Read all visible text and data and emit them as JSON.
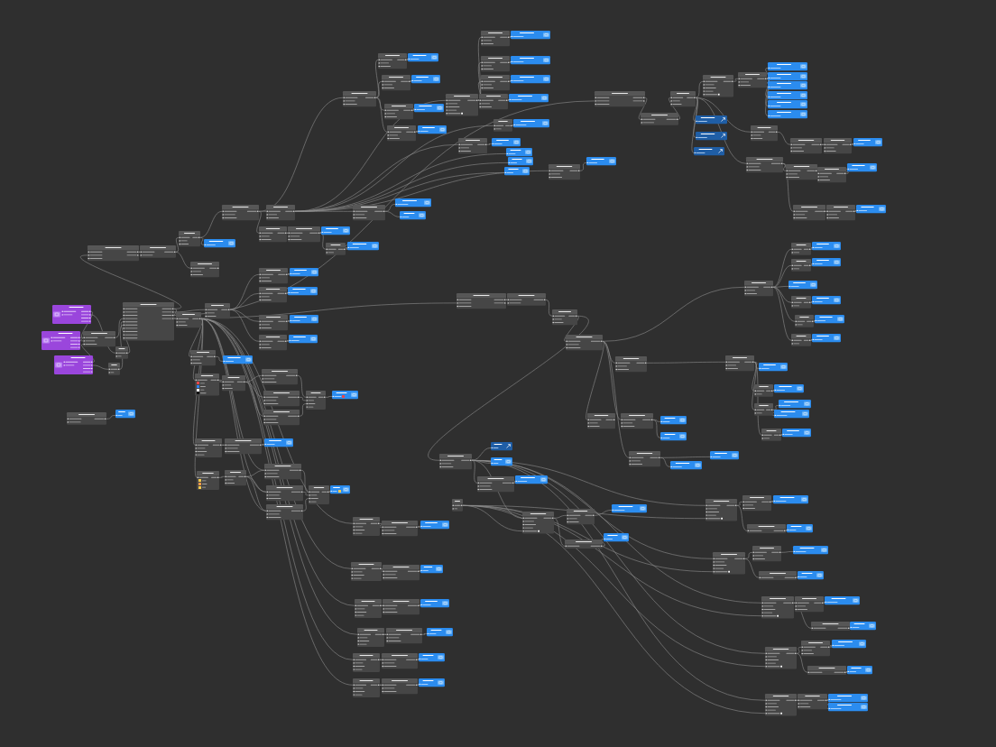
{
  "canvas": {
    "nodes": [
      {
        "kind": "patch",
        "rows": [
          {
            "kind": "pair"
          },
          {
            "kind": "input"
          },
          {
            "kind": "input"
          }
        ]
      },
      {
        "kind": "layer"
      },
      {
        "kind": "patch",
        "rows": [
          {
            "kind": "pair"
          },
          {
            "kind": "input"
          },
          {
            "kind": "input"
          }
        ]
      },
      {
        "kind": "layer"
      },
      {
        "kind": "patch",
        "rows": [
          {
            "kind": "pair"
          },
          {
            "kind": "input"
          },
          {
            "kind": "input"
          }
        ]
      },
      {
        "kind": "layer"
      },
      {
        "kind": "patch",
        "rows": [
          {
            "kind": "pair"
          },
          {
            "kind": "input"
          },
          {
            "kind": "input"
          }
        ]
      },
      {
        "kind": "layer"
      },
      {
        "kind": "patch",
        "rows": [
          {
            "kind": "pair"
          },
          {
            "kind": "input"
          },
          {
            "kind": "input"
          }
        ]
      },
      {
        "kind": "layer"
      },
      {
        "kind": "patch",
        "rows": [
          {
            "kind": "pair"
          },
          {
            "kind": "input"
          },
          {
            "kind": "input"
          }
        ]
      },
      {
        "kind": "patch",
        "rows": [
          {
            "kind": "pair"
          },
          {
            "kind": "input"
          },
          {
            "kind": "input"
          },
          {
            "kind": "input"
          },
          {
            "kind": "toggle"
          }
        ]
      },
      {
        "kind": "patch",
        "rows": [
          {
            "kind": "pair"
          },
          {
            "kind": "input"
          },
          {
            "kind": "input"
          }
        ]
      },
      {
        "kind": "layer"
      },
      {
        "kind": "patch",
        "rows": [
          {
            "kind": "pair"
          },
          {
            "kind": "input"
          },
          {
            "kind": "input"
          }
        ]
      },
      {
        "kind": "layer"
      },
      {
        "kind": "patch",
        "rows": [
          {
            "kind": "pair"
          },
          {
            "kind": "input"
          }
        ]
      },
      {
        "kind": "layer"
      },
      {
        "kind": "patch",
        "rows": [
          {
            "kind": "pair"
          },
          {
            "kind": "input"
          },
          {
            "kind": "input"
          }
        ]
      },
      {
        "kind": "layer"
      },
      {
        "kind": "patch",
        "rows": [
          {
            "kind": "pair"
          },
          {
            "kind": "input"
          },
          {
            "kind": "input"
          }
        ]
      },
      {
        "kind": "layer"
      },
      {
        "kind": "layer"
      },
      {
        "kind": "layer"
      },
      {
        "kind": "layer"
      },
      {
        "kind": "patch",
        "rows": [
          {
            "kind": "pair"
          },
          {
            "kind": "input"
          },
          {
            "kind": "input"
          }
        ]
      },
      {
        "kind": "layer"
      },
      {
        "kind": "patch",
        "rows": [
          {
            "kind": "pair"
          },
          {
            "kind": "pair"
          },
          {
            "kind": "input"
          }
        ]
      },
      {
        "kind": "patch",
        "rows": [
          {
            "kind": "pair"
          },
          {
            "kind": "input"
          }
        ]
      },
      {
        "kind": "patch",
        "rows": [
          {
            "kind": "pair"
          },
          {
            "kind": "input"
          },
          {
            "kind": "input"
          }
        ]
      },
      {
        "kind": "patch",
        "rows": [
          {
            "kind": "pair"
          },
          {
            "kind": "input"
          },
          {
            "kind": "input"
          },
          {
            "kind": "input"
          },
          {
            "kind": "toggle"
          }
        ]
      },
      {
        "kind": "patch",
        "rows": [
          {
            "kind": "pair"
          },
          {
            "kind": "input"
          },
          {
            "kind": "input"
          }
        ]
      },
      {
        "kind": "layer"
      },
      {
        "kind": "layer"
      },
      {
        "kind": "layer"
      },
      {
        "kind": "layer"
      },
      {
        "kind": "layer"
      },
      {
        "kind": "layer"
      },
      {
        "kind": "group"
      },
      {
        "kind": "group"
      },
      {
        "kind": "group"
      },
      {
        "kind": "patch",
        "rows": [
          {
            "kind": "pair"
          },
          {
            "kind": "input"
          },
          {
            "kind": "input"
          }
        ]
      },
      {
        "kind": "patch",
        "rows": [
          {
            "kind": "pair"
          },
          {
            "kind": "input"
          },
          {
            "kind": "input"
          }
        ]
      },
      {
        "kind": "patch",
        "rows": [
          {
            "kind": "pair"
          },
          {
            "kind": "input"
          },
          {
            "kind": "input"
          }
        ]
      },
      {
        "kind": "layer"
      },
      {
        "kind": "patch",
        "rows": [
          {
            "kind": "pair"
          },
          {
            "kind": "input"
          },
          {
            "kind": "input"
          }
        ]
      },
      {
        "kind": "patch",
        "rows": [
          {
            "kind": "pair"
          },
          {
            "kind": "input"
          },
          {
            "kind": "input"
          }
        ]
      },
      {
        "kind": "patch",
        "rows": [
          {
            "kind": "pair"
          },
          {
            "kind": "input"
          },
          {
            "kind": "input"
          }
        ]
      },
      {
        "kind": "layer"
      },
      {
        "kind": "patch",
        "rows": [
          {
            "kind": "pair"
          },
          {
            "kind": "input"
          },
          {
            "kind": "input"
          }
        ]
      },
      {
        "kind": "patch",
        "rows": [
          {
            "kind": "pair"
          },
          {
            "kind": "input"
          },
          {
            "kind": "input"
          }
        ]
      },
      {
        "kind": "layer"
      },
      {
        "kind": "patch",
        "rows": [
          {
            "kind": "pair"
          },
          {
            "kind": "input"
          },
          {
            "kind": "input"
          }
        ]
      },
      {
        "kind": "patch",
        "rows": [
          {
            "kind": "pair"
          },
          {
            "kind": "input"
          },
          {
            "kind": "input"
          }
        ]
      },
      {
        "kind": "patch",
        "rows": [
          {
            "kind": "pair"
          },
          {
            "kind": "input"
          },
          {
            "kind": "input"
          }
        ]
      },
      {
        "kind": "layer"
      },
      {
        "kind": "layer"
      },
      {
        "kind": "patch",
        "rows": [
          {
            "kind": "pair"
          },
          {
            "kind": "input"
          },
          {
            "kind": "input"
          }
        ]
      },
      {
        "kind": "layer"
      },
      {
        "kind": "patch",
        "rows": [
          {
            "kind": "pair"
          },
          {
            "kind": "input"
          },
          {
            "kind": "input"
          }
        ]
      },
      {
        "kind": "patch",
        "rows": [
          {
            "kind": "pair"
          },
          {
            "kind": "input"
          },
          {
            "kind": "input"
          }
        ]
      },
      {
        "kind": "layer"
      },
      {
        "kind": "patch",
        "rows": [
          {
            "kind": "pair"
          },
          {
            "kind": "input"
          }
        ]
      },
      {
        "kind": "layer"
      },
      {
        "kind": "patch",
        "rows": [
          {
            "kind": "pair"
          },
          {
            "kind": "pair"
          },
          {
            "kind": "input"
          }
        ]
      },
      {
        "kind": "patch",
        "rows": [
          {
            "kind": "pair"
          },
          {
            "kind": "input"
          }
        ]
      },
      {
        "kind": "patch",
        "rows": [
          {
            "kind": "pair"
          },
          {
            "kind": "input"
          },
          {
            "kind": "input"
          }
        ]
      },
      {
        "kind": "patch",
        "rows": [
          {
            "kind": "pair"
          },
          {
            "kind": "input"
          },
          {
            "kind": "input"
          }
        ]
      },
      {
        "kind": "layer"
      },
      {
        "kind": "patch",
        "rows": [
          {
            "kind": "pair"
          },
          {
            "kind": "input"
          },
          {
            "kind": "input"
          }
        ]
      },
      {
        "kind": "layer"
      },
      {
        "kind": "patch",
        "rows": [
          {
            "kind": "pair"
          },
          {
            "kind": "input"
          },
          {
            "kind": "input"
          }
        ]
      },
      {
        "kind": "layer"
      },
      {
        "kind": "patch",
        "rows": [
          {
            "kind": "pair"
          },
          {
            "kind": "input"
          },
          {
            "kind": "input"
          }
        ]
      },
      {
        "kind": "layer"
      },
      {
        "kind": "interaction",
        "rows": [
          {
            "kind": "pair"
          },
          {
            "kind": "pair"
          },
          {
            "kind": "output"
          },
          {
            "kind": "output"
          }
        ]
      },
      {
        "kind": "interaction",
        "rows": [
          {
            "kind": "pair"
          },
          {
            "kind": "pair"
          },
          {
            "kind": "output"
          },
          {
            "kind": "output"
          }
        ]
      },
      {
        "kind": "interaction",
        "rows": [
          {
            "kind": "pair"
          },
          {
            "kind": "pair"
          },
          {
            "kind": "output"
          },
          {
            "kind": "output"
          }
        ]
      },
      {
        "kind": "patch",
        "rows": [
          {
            "kind": "pair"
          },
          {
            "kind": "input"
          },
          {
            "kind": "input"
          }
        ]
      },
      {
        "kind": "patch",
        "rows": [
          {
            "kind": "pair"
          },
          {
            "kind": "input"
          }
        ]
      },
      {
        "kind": "patch",
        "rows": [
          {
            "kind": "pair"
          },
          {
            "kind": "input"
          }
        ]
      },
      {
        "kind": "patch",
        "rows": [
          {
            "kind": "pair"
          },
          {
            "kind": "pair"
          },
          {
            "kind": "pair"
          },
          {
            "kind": "pair"
          },
          {
            "kind": "input"
          },
          {
            "kind": "input"
          },
          {
            "kind": "input"
          },
          {
            "kind": "input"
          },
          {
            "kind": "input"
          },
          {
            "kind": "input"
          }
        ]
      },
      {
        "kind": "patch",
        "rows": [
          {
            "kind": "pair"
          },
          {
            "kind": "input"
          },
          {
            "kind": "input"
          }
        ]
      },
      {
        "kind": "patch",
        "rows": [
          {
            "kind": "pair"
          },
          {
            "kind": "input"
          },
          {
            "kind": "input"
          }
        ]
      },
      {
        "kind": "patch",
        "rows": [
          {
            "kind": "pair"
          },
          {
            "kind": "input"
          },
          {
            "kind": "input"
          }
        ]
      },
      {
        "kind": "layer"
      },
      {
        "kind": "patch",
        "rows": [
          {
            "kind": "pair"
          },
          {
            "kind": "input"
          }
        ]
      },
      {
        "kind": "layer"
      },
      {
        "kind": "patch",
        "rows": [
          {
            "kind": "pair"
          },
          {
            "kind": "swatch",
            "color": "#e5484d"
          },
          {
            "kind": "swatch",
            "color": "#2f80ed"
          },
          {
            "kind": "swatch",
            "color": "#ffffff"
          },
          {
            "kind": "swatch",
            "color": "#111111"
          }
        ]
      },
      {
        "kind": "patch",
        "rows": [
          {
            "kind": "pair"
          },
          {
            "kind": "input"
          },
          {
            "kind": "input"
          }
        ]
      },
      {
        "kind": "patch",
        "rows": [
          {
            "kind": "pair"
          },
          {
            "kind": "input"
          },
          {
            "kind": "input"
          }
        ]
      },
      {
        "kind": "patch",
        "rows": [
          {
            "kind": "pair"
          },
          {
            "kind": "input"
          },
          {
            "kind": "input"
          }
        ]
      },
      {
        "kind": "patch",
        "rows": [
          {
            "kind": "pair"
          },
          {
            "kind": "input"
          },
          {
            "kind": "input"
          }
        ]
      },
      {
        "kind": "patch",
        "rows": [
          {
            "kind": "pair"
          },
          {
            "kind": "input"
          },
          {
            "kind": "input"
          },
          {
            "kind": "input"
          }
        ]
      },
      {
        "kind": "layer",
        "color": "#e5484d"
      },
      {
        "kind": "patch",
        "rows": [
          {
            "kind": "pair"
          },
          {
            "kind": "input"
          },
          {
            "kind": "input"
          },
          {
            "kind": "input"
          }
        ]
      },
      {
        "kind": "patch",
        "rows": [
          {
            "kind": "pair"
          },
          {
            "kind": "input"
          },
          {
            "kind": "input"
          }
        ]
      },
      {
        "kind": "layer"
      },
      {
        "kind": "patch",
        "rows": [
          {
            "kind": "pair"
          },
          {
            "kind": "swatch",
            "color": "#f2c94c"
          },
          {
            "kind": "swatch",
            "color": "#f2994a"
          },
          {
            "kind": "swatch",
            "color": "#f2c94c"
          }
        ]
      },
      {
        "kind": "patch",
        "rows": [
          {
            "kind": "pair"
          },
          {
            "kind": "input"
          },
          {
            "kind": "input"
          }
        ]
      },
      {
        "kind": "patch",
        "rows": [
          {
            "kind": "pair"
          },
          {
            "kind": "input"
          },
          {
            "kind": "input"
          }
        ]
      },
      {
        "kind": "patch",
        "rows": [
          {
            "kind": "pair"
          },
          {
            "kind": "input"
          },
          {
            "kind": "input"
          }
        ]
      },
      {
        "kind": "patch",
        "rows": [
          {
            "kind": "pair"
          },
          {
            "kind": "input"
          },
          {
            "kind": "input"
          }
        ]
      },
      {
        "kind": "patch",
        "rows": [
          {
            "kind": "pair"
          },
          {
            "kind": "input"
          },
          {
            "kind": "input"
          },
          {
            "kind": "input"
          }
        ]
      },
      {
        "kind": "layer",
        "color": "#f2c94c"
      },
      {
        "kind": "patch",
        "rows": [
          {
            "kind": "pair"
          },
          {
            "kind": "input"
          },
          {
            "kind": "input"
          },
          {
            "kind": "input"
          }
        ]
      },
      {
        "kind": "patch",
        "rows": [
          {
            "kind": "pair"
          },
          {
            "kind": "input"
          },
          {
            "kind": "input"
          }
        ]
      },
      {
        "kind": "layer"
      },
      {
        "kind": "patch",
        "rows": [
          {
            "kind": "pair"
          },
          {
            "kind": "input"
          },
          {
            "kind": "input"
          },
          {
            "kind": "input"
          }
        ]
      },
      {
        "kind": "patch",
        "rows": [
          {
            "kind": "pair"
          },
          {
            "kind": "input"
          },
          {
            "kind": "input"
          }
        ]
      },
      {
        "kind": "layer"
      },
      {
        "kind": "patch",
        "rows": [
          {
            "kind": "pair"
          },
          {
            "kind": "input"
          },
          {
            "kind": "input"
          },
          {
            "kind": "input"
          }
        ]
      },
      {
        "kind": "patch",
        "rows": [
          {
            "kind": "pair"
          },
          {
            "kind": "input"
          },
          {
            "kind": "input"
          }
        ]
      },
      {
        "kind": "layer"
      },
      {
        "kind": "patch",
        "rows": [
          {
            "kind": "pair"
          },
          {
            "kind": "input"
          },
          {
            "kind": "input"
          },
          {
            "kind": "input"
          }
        ]
      },
      {
        "kind": "patch",
        "rows": [
          {
            "kind": "pair"
          },
          {
            "kind": "input"
          },
          {
            "kind": "input"
          }
        ]
      },
      {
        "kind": "layer"
      },
      {
        "kind": "patch",
        "rows": [
          {
            "kind": "pair"
          },
          {
            "kind": "input"
          },
          {
            "kind": "input"
          },
          {
            "kind": "input"
          }
        ]
      },
      {
        "kind": "patch",
        "rows": [
          {
            "kind": "pair"
          },
          {
            "kind": "input"
          },
          {
            "kind": "input"
          }
        ]
      },
      {
        "kind": "layer"
      },
      {
        "kind": "patch",
        "rows": [
          {
            "kind": "pair"
          },
          {
            "kind": "input"
          },
          {
            "kind": "input"
          },
          {
            "kind": "input"
          }
        ]
      },
      {
        "kind": "patch",
        "rows": [
          {
            "kind": "pair"
          },
          {
            "kind": "input"
          },
          {
            "kind": "input"
          }
        ]
      },
      {
        "kind": "layer"
      },
      {
        "kind": "patch",
        "rows": [
          {
            "kind": "pair"
          },
          {
            "kind": "pair"
          },
          {
            "kind": "input"
          }
        ]
      },
      {
        "kind": "patch",
        "rows": [
          {
            "kind": "pair"
          },
          {
            "kind": "input"
          }
        ]
      },
      {
        "kind": "patch",
        "rows": [
          {
            "kind": "pair"
          },
          {
            "kind": "input"
          },
          {
            "kind": "input"
          }
        ]
      },
      {
        "kind": "patch",
        "rows": [
          {
            "kind": "pair"
          },
          {
            "kind": "input"
          },
          {
            "kind": "input"
          }
        ]
      },
      {
        "kind": "patch",
        "rows": [
          {
            "kind": "pair"
          },
          {
            "kind": "input"
          },
          {
            "kind": "input"
          }
        ]
      },
      {
        "kind": "patch",
        "rows": [
          {
            "kind": "pair"
          },
          {
            "kind": "input"
          }
        ]
      },
      {
        "kind": "layer"
      },
      {
        "kind": "patch",
        "rows": [
          {
            "kind": "pair"
          },
          {
            "kind": "input"
          }
        ]
      },
      {
        "kind": "layer"
      },
      {
        "kind": "layer"
      },
      {
        "kind": "patch",
        "rows": [
          {
            "kind": "pair"
          },
          {
            "kind": "input"
          }
        ]
      },
      {
        "kind": "layer"
      },
      {
        "kind": "patch",
        "rows": [
          {
            "kind": "pair"
          },
          {
            "kind": "input"
          }
        ]
      },
      {
        "kind": "layer"
      },
      {
        "kind": "patch",
        "rows": [
          {
            "kind": "pair"
          },
          {
            "kind": "input"
          }
        ]
      },
      {
        "kind": "layer"
      },
      {
        "kind": "patch",
        "rows": [
          {
            "kind": "pair"
          },
          {
            "kind": "input"
          },
          {
            "kind": "input"
          }
        ]
      },
      {
        "kind": "patch",
        "rows": [
          {
            "kind": "pair"
          },
          {
            "kind": "input"
          },
          {
            "kind": "input"
          }
        ]
      },
      {
        "kind": "layer"
      },
      {
        "kind": "patch",
        "rows": [
          {
            "kind": "pair"
          },
          {
            "kind": "input"
          }
        ]
      },
      {
        "kind": "layer"
      },
      {
        "kind": "patch",
        "rows": [
          {
            "kind": "pair"
          },
          {
            "kind": "input"
          }
        ]
      },
      {
        "kind": "layer"
      },
      {
        "kind": "layer"
      },
      {
        "kind": "patch",
        "rows": [
          {
            "kind": "pair"
          },
          {
            "kind": "input"
          }
        ]
      },
      {
        "kind": "layer"
      },
      {
        "kind": "patch",
        "rows": [
          {
            "kind": "pair"
          },
          {
            "kind": "input"
          },
          {
            "kind": "input"
          }
        ]
      },
      {
        "kind": "patch",
        "rows": [
          {
            "kind": "pair"
          },
          {
            "kind": "input"
          },
          {
            "kind": "input"
          }
        ]
      },
      {
        "kind": "layer"
      },
      {
        "kind": "layer"
      },
      {
        "kind": "patch",
        "rows": [
          {
            "kind": "pair"
          },
          {
            "kind": "input"
          },
          {
            "kind": "input"
          }
        ]
      },
      {
        "kind": "layer"
      },
      {
        "kind": "layer"
      },
      {
        "kind": "patch",
        "rows": [
          {
            "kind": "pair"
          },
          {
            "kind": "input"
          },
          {
            "kind": "input"
          }
        ]
      },
      {
        "kind": "group"
      },
      {
        "kind": "layer"
      },
      {
        "kind": "patch",
        "rows": [
          {
            "kind": "pair"
          },
          {
            "kind": "input"
          },
          {
            "kind": "input"
          }
        ]
      },
      {
        "kind": "layer"
      },
      {
        "kind": "patch",
        "rows": [
          {
            "kind": "pair"
          },
          {
            "kind": "input"
          }
        ]
      },
      {
        "kind": "patch",
        "rows": [
          {
            "kind": "pair"
          },
          {
            "kind": "input"
          },
          {
            "kind": "input"
          },
          {
            "kind": "input"
          },
          {
            "kind": "toggle"
          }
        ]
      },
      {
        "kind": "patch",
        "rows": [
          {
            "kind": "pair"
          },
          {
            "kind": "input"
          },
          {
            "kind": "input"
          }
        ]
      },
      {
        "kind": "layer"
      },
      {
        "kind": "patch",
        "rows": [
          {
            "kind": "pair"
          }
        ]
      },
      {
        "kind": "layer"
      },
      {
        "kind": "patch",
        "rows": [
          {
            "kind": "pair"
          },
          {
            "kind": "input"
          },
          {
            "kind": "input"
          },
          {
            "kind": "input"
          },
          {
            "kind": "toggle"
          }
        ]
      },
      {
        "kind": "patch",
        "rows": [
          {
            "kind": "pair"
          },
          {
            "kind": "input"
          },
          {
            "kind": "input"
          }
        ]
      },
      {
        "kind": "layer"
      },
      {
        "kind": "patch",
        "rows": [
          {
            "kind": "pair"
          }
        ]
      },
      {
        "kind": "layer"
      },
      {
        "kind": "patch",
        "rows": [
          {
            "kind": "pair"
          },
          {
            "kind": "input"
          },
          {
            "kind": "input"
          },
          {
            "kind": "input"
          },
          {
            "kind": "toggle"
          }
        ]
      },
      {
        "kind": "patch",
        "rows": [
          {
            "kind": "pair"
          },
          {
            "kind": "input"
          },
          {
            "kind": "input"
          }
        ]
      },
      {
        "kind": "layer"
      },
      {
        "kind": "patch",
        "rows": [
          {
            "kind": "pair"
          }
        ]
      },
      {
        "kind": "layer"
      },
      {
        "kind": "patch",
        "rows": [
          {
            "kind": "pair"
          },
          {
            "kind": "input"
          },
          {
            "kind": "input"
          },
          {
            "kind": "input"
          },
          {
            "kind": "toggle"
          }
        ]
      },
      {
        "kind": "patch",
        "rows": [
          {
            "kind": "pair"
          },
          {
            "kind": "input"
          },
          {
            "kind": "input"
          }
        ]
      },
      {
        "kind": "layer"
      },
      {
        "kind": "patch",
        "rows": [
          {
            "kind": "pair"
          }
        ]
      },
      {
        "kind": "layer"
      },
      {
        "kind": "patch",
        "rows": [
          {
            "kind": "pair"
          },
          {
            "kind": "input"
          },
          {
            "kind": "input"
          },
          {
            "kind": "input"
          },
          {
            "kind": "toggle"
          }
        ]
      },
      {
        "kind": "patch",
        "rows": [
          {
            "kind": "pair"
          },
          {
            "kind": "input"
          },
          {
            "kind": "input"
          }
        ]
      },
      {
        "kind": "layer"
      },
      {
        "kind": "patch",
        "rows": [
          {
            "kind": "pair"
          }
        ]
      },
      {
        "kind": "layer"
      },
      {
        "kind": "patch",
        "rows": [
          {
            "kind": "pair"
          },
          {
            "kind": "input"
          },
          {
            "kind": "input"
          },
          {
            "kind": "input"
          },
          {
            "kind": "toggle"
          }
        ]
      },
      {
        "kind": "patch",
        "rows": [
          {
            "kind": "pair"
          },
          {
            "kind": "input"
          },
          {
            "kind": "input"
          }
        ]
      },
      {
        "kind": "layer"
      },
      {
        "kind": "layer"
      }
    ]
  }
}
